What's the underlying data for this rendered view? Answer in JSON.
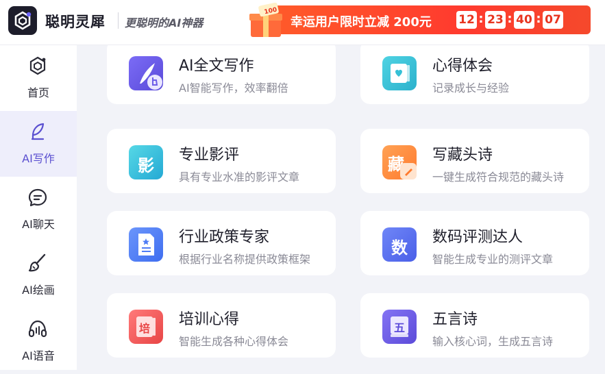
{
  "header": {
    "brand": "聪明灵犀",
    "slogan": "更聪明的AI神器",
    "promo": {
      "text": "幸运用户限时立减 200元",
      "gift_badge": "100",
      "timer": [
        "12",
        "23",
        "40",
        "07"
      ],
      "timer_sep": ":"
    }
  },
  "sidebar": {
    "items": [
      {
        "label": "首页",
        "icon": "home-logo-icon",
        "active": false
      },
      {
        "label": "AI写作",
        "icon": "feather-pen-icon",
        "active": true
      },
      {
        "label": "AI聊天",
        "icon": "chat-bubble-icon",
        "active": false
      },
      {
        "label": "AI绘画",
        "icon": "paint-brush-icon",
        "active": false
      },
      {
        "label": "AI语音",
        "icon": "headphones-icon",
        "active": false
      }
    ]
  },
  "cards": [
    {
      "title": "AI全文写作",
      "desc": "AI智能写作，效率翻倍",
      "icon": "pen-nib-icon",
      "color": "#6c5ce7"
    },
    {
      "title": "心得体会",
      "desc": "记录成长与经验",
      "icon": "heart-book-icon",
      "color": "#35c0d6"
    },
    {
      "title": "专业影评",
      "desc": "具有专业水准的影评文章",
      "icon": "ying-char-icon",
      "icon_text": "影",
      "color": "#34c3dd"
    },
    {
      "title": "写藏头诗",
      "desc": "一键生成符合规范的藏头诗",
      "icon": "cang-char-icon",
      "icon_text": "藏",
      "color": "#ff8a3d"
    },
    {
      "title": "行业政策专家",
      "desc": "根据行业名称提供政策框架",
      "icon": "policy-document-icon",
      "color": "#4f7df5"
    },
    {
      "title": "数码评测达人",
      "desc": "智能生成专业的测评文章",
      "icon": "shu-char-icon",
      "icon_text": "数",
      "color": "#5b72f2"
    },
    {
      "title": "培训心得",
      "desc": "智能生成各种心得体会",
      "icon": "pei-book-icon",
      "icon_text": "培",
      "color": "#f05a5a"
    },
    {
      "title": "五言诗",
      "desc": "输入核心词，生成五言诗",
      "icon": "wu-book-icon",
      "icon_text": "五",
      "color": "#6a5ce6"
    }
  ]
}
